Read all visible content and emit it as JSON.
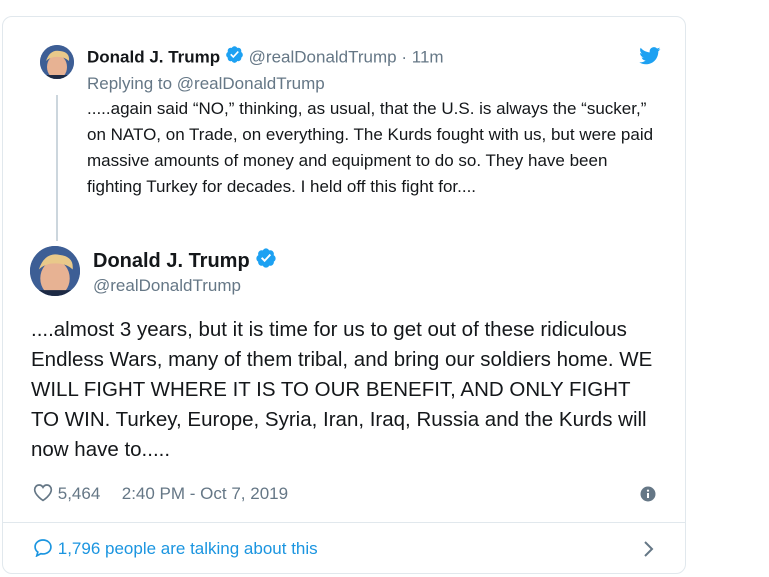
{
  "reply_tweet": {
    "author_name": "Donald J. Trump",
    "author_handle": "@realDonaldTrump",
    "separator": "·",
    "time_ago": "11m",
    "replying_to": "Replying to @realDonaldTrump",
    "text": ".....again said “NO,” thinking, as usual, that the U.S. is always the “sucker,” on NATO, on Trade, on everything. The Kurds fought with us, but were paid massive amounts of money and equipment to do so. They have been fighting Turkey for decades. I held off this fight for...."
  },
  "main_tweet": {
    "author_name": "Donald J. Trump",
    "author_handle": "@realDonaldTrump",
    "text": "....almost 3 years, but it is time for us to get out of these ridiculous Endless Wars, many of them tribal, and bring our soldiers home. WE WILL FIGHT WHERE IT IS TO OUR BENEFIT, AND ONLY FIGHT TO WIN. Turkey, Europe, Syria, Iran, Iraq, Russia and the Kurds will now have to.....",
    "like_count": "5,464",
    "timestamp": "2:40 PM - Oct 7, 2019"
  },
  "footer": {
    "conversation_text": "1,796 people are talking about this"
  },
  "icons": {
    "brand": "twitter-bird-icon",
    "verified": "verified-badge-icon",
    "like": "heart-icon",
    "info": "info-icon",
    "reply": "speech-bubble-icon",
    "chevron": "chevron-right-icon"
  },
  "colors": {
    "twitter_blue": "#1da1f2",
    "link_blue": "#1b95e0",
    "muted_gray": "#657786",
    "border": "#e1e8ed"
  }
}
